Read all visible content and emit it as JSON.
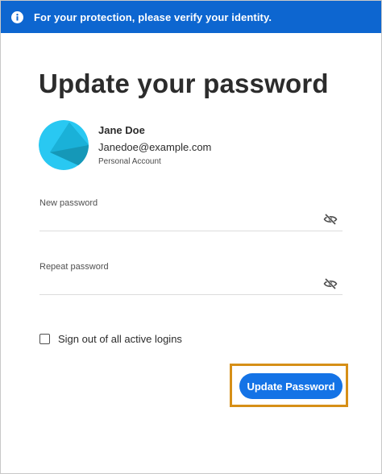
{
  "banner": {
    "icon": "info-icon",
    "text": "For your protection, please verify your identity."
  },
  "page_title": "Update your password",
  "user": {
    "avatar_icon": "avatar-icon",
    "name": "Jane Doe",
    "email": "Janedoe@example.com",
    "account_type": "Personal Account"
  },
  "fields": {
    "new_password": {
      "label": "New password",
      "value": "",
      "toggle_icon": "eye-slash-icon"
    },
    "repeat_password": {
      "label": "Repeat password",
      "value": "",
      "toggle_icon": "eye-slash-icon"
    }
  },
  "sign_out": {
    "label": "Sign out of all active logins",
    "checked": false
  },
  "submit_button": {
    "label": "Update Password"
  },
  "colors": {
    "banner": "#0d66d0",
    "button": "#1473e6",
    "highlight": "#d68f17",
    "avatar_light": "#29c8f2",
    "avatar_dark": "#1598b8"
  }
}
